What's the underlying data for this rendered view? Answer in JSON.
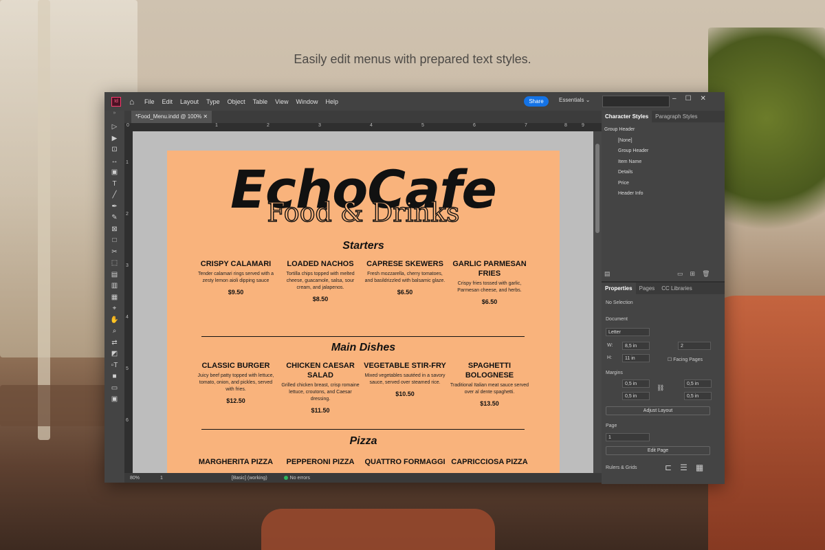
{
  "tagline": "Easily edit menus with prepared text styles.",
  "app": {
    "logo": "Id",
    "menu": [
      "File",
      "Edit",
      "Layout",
      "Type",
      "Object",
      "Table",
      "View",
      "Window",
      "Help"
    ],
    "share_label": "Share",
    "workspace": "Essentials",
    "doc_tab": "*Food_Menu.indd @ 100%",
    "ruler_h": [
      "0",
      "1",
      "2",
      "3",
      "4",
      "5",
      "6",
      "7",
      "8",
      "9"
    ],
    "ruler_v": [
      "1",
      "2",
      "3",
      "4",
      "5",
      "6"
    ],
    "status": {
      "zoom": "80%",
      "page": "1",
      "style": "[Basic] (working)",
      "errors": "No errors"
    }
  },
  "menu_page": {
    "title": "EchoCafe",
    "subtitle": "Food & Drinks",
    "sections": [
      {
        "name": "Starters",
        "items": [
          {
            "name": "CRISPY CALAMARI",
            "desc": "Tender calamari rings served with a zesty lemon aioli dipping sauce",
            "price": "$9.50"
          },
          {
            "name": "LOADED NACHOS",
            "desc": "Tortilla chips topped with melted cheese, guacamole, salsa, sour cream, and jalapenos.",
            "price": "$8.50"
          },
          {
            "name": "CAPRESE SKEWERS",
            "desc": "Fresh mozzarella, cherry tomatoes, and basildrizzled with balsamic glaze.",
            "price": "$6.50"
          },
          {
            "name": "GARLIC PARMESAN FRIES",
            "desc": "Crispy fries tossed with garlic, Parmesan cheese, and herbs.",
            "price": "$6.50"
          }
        ]
      },
      {
        "name": "Main Dishes",
        "items": [
          {
            "name": "CLASSIC BURGER",
            "desc": "Juicy beef patty topped with lettuce, tomato, onion, and pickles, served with fries.",
            "price": "$12.50"
          },
          {
            "name": "CHICKEN CAESAR SALAD",
            "desc": "Grilled chicken breast, crisp romaine lettuce, croutons, and Caesar dressing.",
            "price": "$11.50"
          },
          {
            "name": "VEGETABLE STIR-FRY",
            "desc": "Mixed vegetables sautéed in a savory sauce, served over steamed rice.",
            "price": "$10.50"
          },
          {
            "name": "SPAGHETTI BOLOGNESE",
            "desc": "Traditional Italian meat sauce served over al dente spaghetti.",
            "price": "$13.50"
          }
        ]
      },
      {
        "name": "Pizza",
        "items": [
          {
            "name": "MARGHERITA PIZZA",
            "desc": "",
            "price": ""
          },
          {
            "name": "PEPPERONI PIZZA",
            "desc": "",
            "price": ""
          },
          {
            "name": "QUATTRO FORMAGGI",
            "desc": "",
            "price": ""
          },
          {
            "name": "CAPRICCIOSA PIZZA",
            "desc": "",
            "price": ""
          }
        ]
      }
    ]
  },
  "styles_panel": {
    "tabs": [
      "Character Styles",
      "Paragraph Styles"
    ],
    "group": "Group Header",
    "items": [
      "[None]",
      "Group Header",
      "Item Name",
      "Details",
      "Price",
      "Header Info"
    ]
  },
  "properties": {
    "tabs": [
      "Properties",
      "Pages",
      "CC Libraries"
    ],
    "selection": "No Selection",
    "document_label": "Document",
    "size": "Letter",
    "w_label": "W:",
    "w": "8,5 in",
    "h_label": "H:",
    "h": "11 in",
    "pages": "2",
    "facing": "Facing Pages",
    "margins_label": "Margins",
    "margin_top": "0,5 in",
    "margin_bottom": "0,5 in",
    "margin_left": "0,5 in",
    "margin_right": "0,5 in",
    "adjust": "Adjust Layout",
    "page_label": "Page",
    "page_value": "1",
    "edit_page": "Edit Page",
    "rulers": "Rulers & Grids"
  }
}
